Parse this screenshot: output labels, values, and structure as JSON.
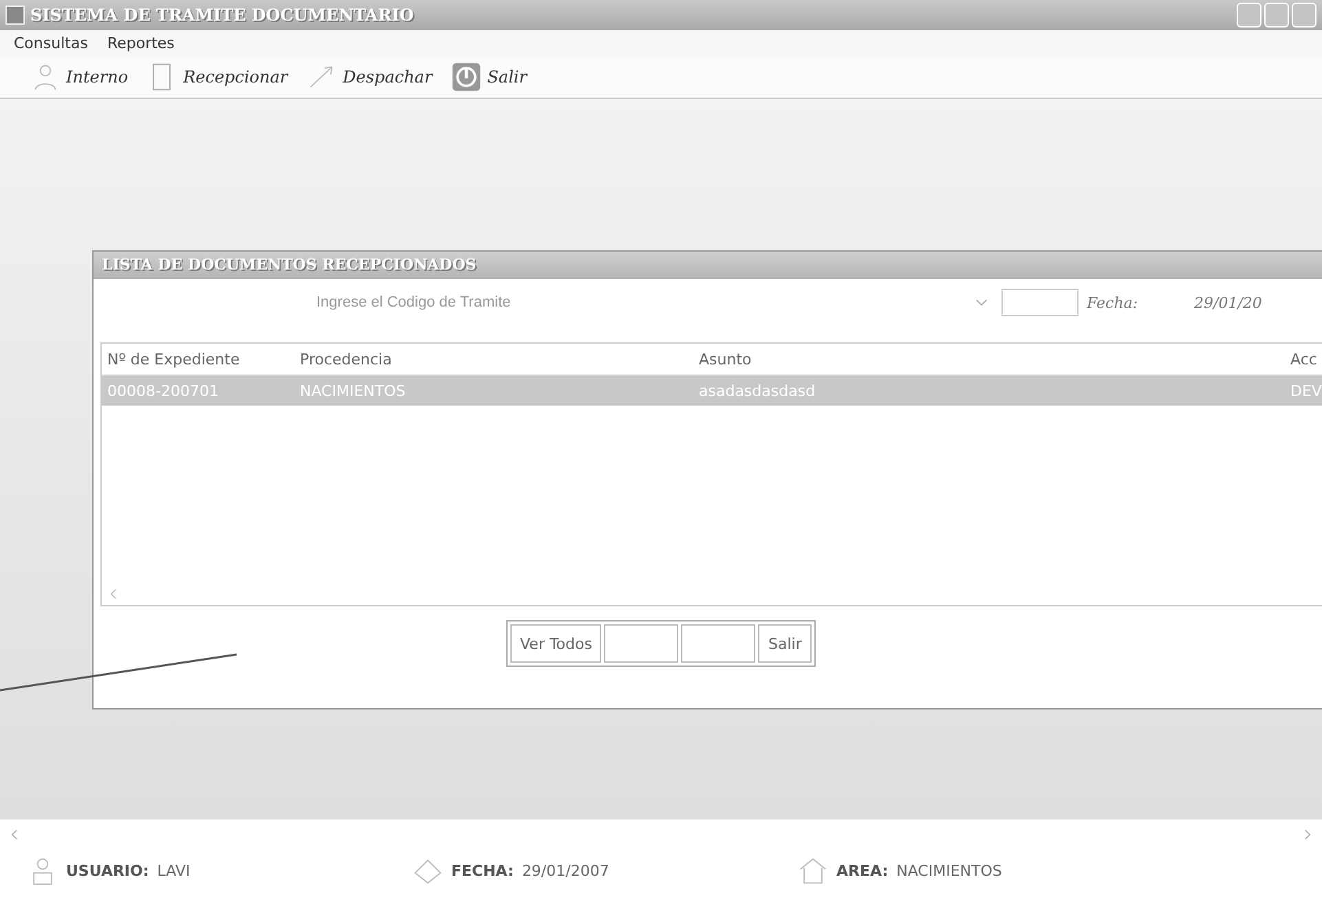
{
  "window": {
    "title": "SISTEMA DE TRAMITE DOCUMENTARIO"
  },
  "menu": [
    "Consultas",
    "Reportes"
  ],
  "toolbar": [
    {
      "label": "Interno",
      "kind": "person"
    },
    {
      "label": "Recepcionar",
      "kind": "document"
    },
    {
      "label": "Despachar",
      "kind": "send"
    },
    {
      "label": "Salir",
      "kind": "exit"
    }
  ],
  "inner_window": {
    "title": "LISTA DE DOCUMENTOS  RECEPCIONADOS",
    "search": {
      "placeholder": "Ingrese el Codigo de Tramite"
    },
    "fecha_label": "Fecha:",
    "fecha_value": "29/01/20",
    "table": {
      "columns": [
        "Nº de Expediente",
        "Procedencia",
        "Asunto",
        "Acc"
      ],
      "rows": [
        {
          "cells": [
            "00008-200701",
            "NACIMIENTOS",
            "asadasdasdasd",
            "DEV"
          ],
          "selected": true
        }
      ]
    },
    "buttons": [
      {
        "label": "Ver Todos",
        "kind": "text"
      },
      {
        "kind": "blank"
      },
      {
        "kind": "blank"
      },
      {
        "label": "Salir",
        "kind": "text"
      }
    ]
  },
  "status_bar": [
    {
      "label": "USUARIO:",
      "value": "LAVI",
      "kind": "user"
    },
    {
      "label": "FECHA:",
      "value": "29/01/2007",
      "kind": "date"
    },
    {
      "label": "AREA:",
      "value": "NACIMIENTOS",
      "kind": "area"
    }
  ]
}
